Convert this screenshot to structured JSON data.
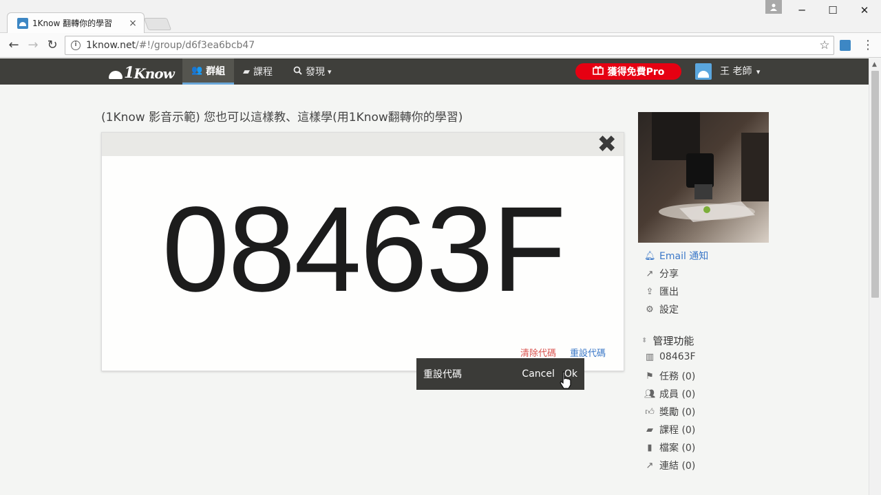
{
  "browser": {
    "tab_title": "1Know 翻轉你的學習",
    "tab_close": "×",
    "url_host": "1know.net",
    "url_path": "/#!/group/d6f3ea6bcb47",
    "window_min": "─",
    "window_max": "☐",
    "window_close": "✕"
  },
  "navbar": {
    "logo": "Know",
    "items": [
      {
        "label": "群組",
        "icon": "users-icon",
        "active": true
      },
      {
        "label": "課程",
        "icon": "book-icon",
        "active": false
      },
      {
        "label": "發現",
        "icon": "search-icon",
        "active": false
      }
    ],
    "discover_caret": "▾",
    "promo_label": "獲得免費Pro",
    "user_name": "王 老師",
    "user_caret": "▾"
  },
  "page": {
    "title": "(1Know 影音示範) 您也可以這樣教、這樣學(用1Know翻轉你的學習)"
  },
  "code_card": {
    "code": "08463F",
    "close_label": "✖",
    "clear_code_label": "清除代碼",
    "reset_code_label": "重設代碼"
  },
  "confirm": {
    "label": "重設代碼",
    "cancel_label": "Cancel",
    "ok_label": "Ok"
  },
  "sidebar": {
    "actions": [
      {
        "label": "Email 通知",
        "icon": "bell-icon"
      },
      {
        "label": "分享",
        "icon": "share-icon"
      },
      {
        "label": "匯出",
        "icon": "upload-icon"
      },
      {
        "label": "設定",
        "icon": "gear-icon"
      }
    ],
    "admin_heading": "管理功能",
    "admin_items": [
      {
        "label": "08463F",
        "icon": "barcode-icon"
      },
      {
        "label": "任務 (0)",
        "icon": "flag-icon"
      },
      {
        "label": "成員 (0)",
        "icon": "users-icon"
      },
      {
        "label": "獎勵 (0)",
        "icon": "thumbs-up-icon"
      },
      {
        "label": "課程 (0)",
        "icon": "book-icon"
      },
      {
        "label": "檔案 (0)",
        "icon": "file-icon"
      },
      {
        "label": "連結 (0)",
        "icon": "external-link-icon"
      }
    ]
  }
}
